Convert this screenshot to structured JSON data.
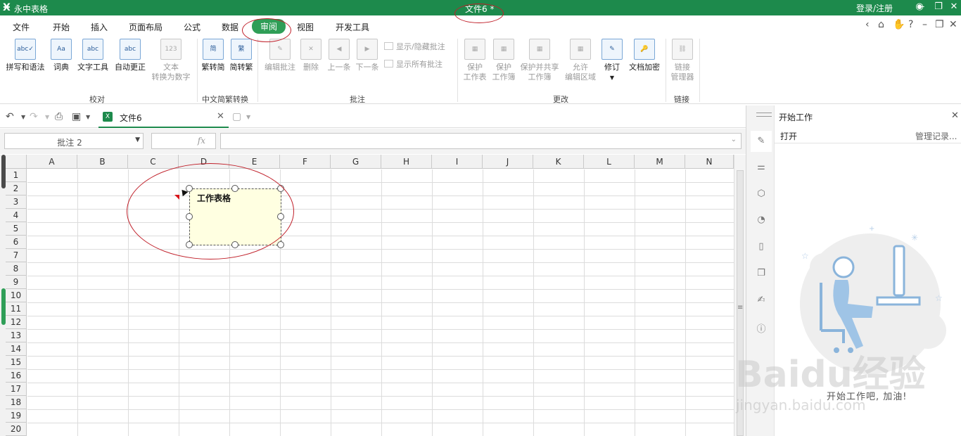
{
  "titlebar": {
    "app_name": "永中表格",
    "doc_title": "文件6 *",
    "login": "登录/注册"
  },
  "menu": {
    "items": [
      "文件",
      "开始",
      "插入",
      "页面布局",
      "公式",
      "数据",
      "审阅",
      "视图",
      "开发工具"
    ],
    "active": "审阅"
  },
  "ribbon": {
    "groups": {
      "proof": "校对",
      "convert": "中文简繁转换",
      "comment": "批注",
      "change": "更改",
      "link": "链接"
    },
    "buttons": {
      "spell": "拼写和语法",
      "dict": "词典",
      "texttool": "文字工具",
      "autocorrect": "自动更正",
      "text2num_1": "文本",
      "text2num_2": "转换为数字",
      "trad2simp": "繁转简",
      "simp2trad": "简转繁",
      "edit_comment": "编辑批注",
      "delete": "删除",
      "prev": "上一条",
      "next": "下一条",
      "show_hide": "显示/隐藏批注",
      "show_all": "显示所有批注",
      "protect_sheet_1": "保护",
      "protect_sheet_2": "工作表",
      "protect_book_1": "保护",
      "protect_book_2": "工作簿",
      "protect_share_1": "保护并共享",
      "protect_share_2": "工作簿",
      "allow_edit_1": "允许",
      "allow_edit_2": "编辑区域",
      "revise": "修订",
      "encrypt": "文档加密",
      "link_mgr_1": "链接",
      "link_mgr_2": "管理器"
    }
  },
  "doc_tab": {
    "name": "文件6"
  },
  "formula_bar": {
    "name_box": "批注 2",
    "fx": "fx",
    "formula": ""
  },
  "columns": [
    "A",
    "B",
    "C",
    "D",
    "E",
    "F",
    "G",
    "H",
    "I",
    "J",
    "K",
    "L",
    "M",
    "N"
  ],
  "rows": [
    "1",
    "2",
    "3",
    "4",
    "5",
    "6",
    "7",
    "8",
    "9",
    "10",
    "11",
    "12",
    "13",
    "14",
    "15",
    "16",
    "17",
    "18",
    "19",
    "20"
  ],
  "comment": {
    "text": "工作表格"
  },
  "side_panel": {
    "title": "开始工作",
    "open": "打开",
    "history": "管理记录...",
    "cheer": "开始工作吧, 加油!"
  },
  "watermark": {
    "brand": "Baidu经验",
    "url": "jingyan.baidu.com"
  }
}
